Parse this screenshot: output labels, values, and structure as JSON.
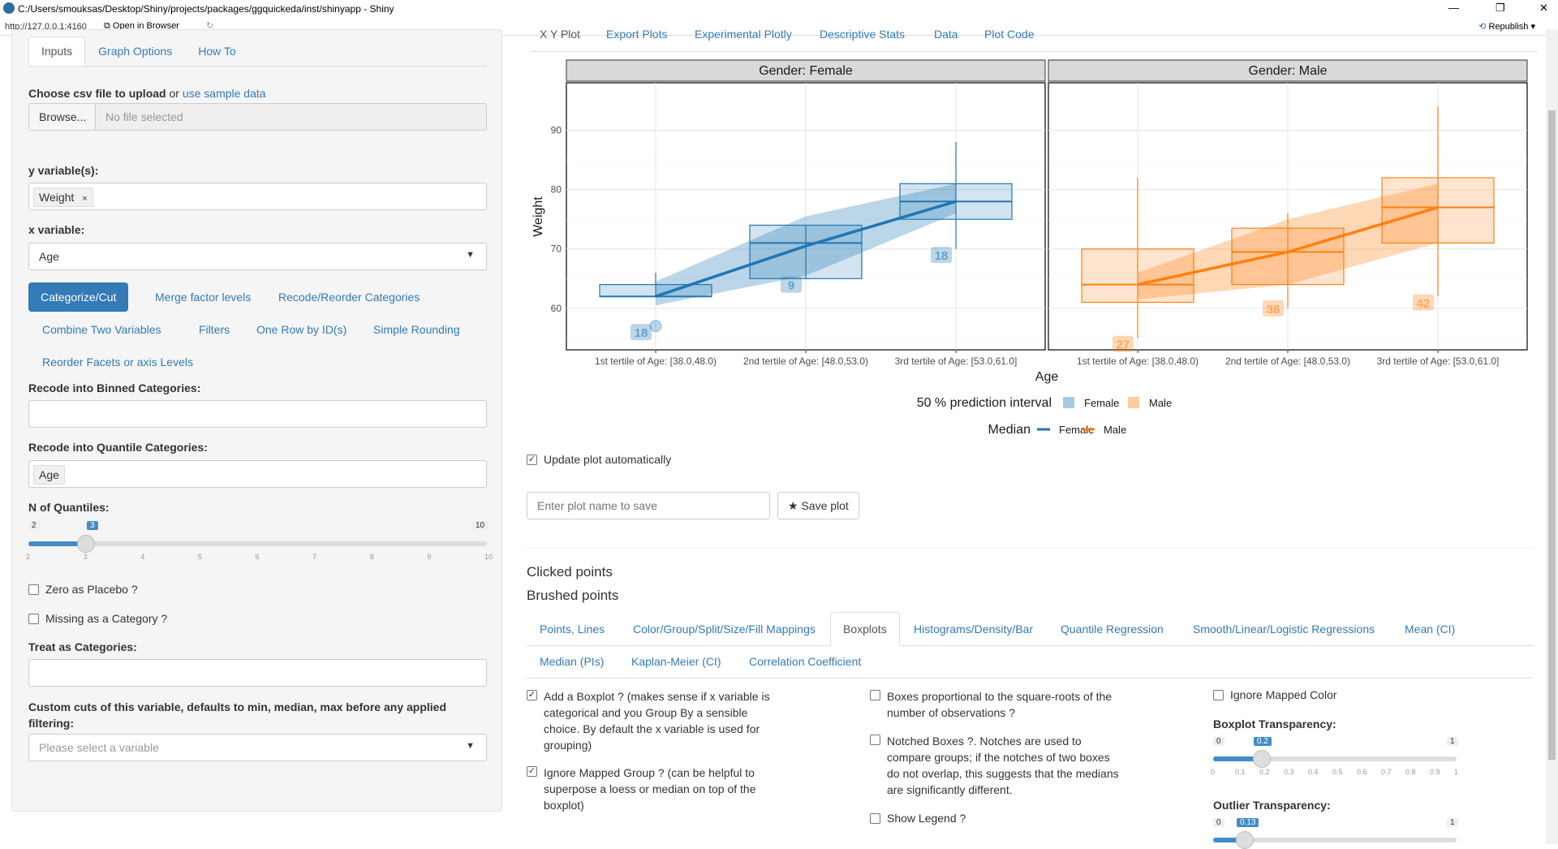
{
  "window": {
    "title": "C:/Users/smouksas/Desktop/Shiny/projects/packages/ggquickeda/inst/shinyapp - Shiny",
    "url": "http://127.0.0.1:4160",
    "open_in_browser": "Open in Browser",
    "republish": "Republish"
  },
  "sidebar": {
    "tabs": [
      "Inputs",
      "Graph Options",
      "How To"
    ],
    "upload_label": "Choose csv file to upload",
    "upload_or": "or",
    "upload_link": "use sample data",
    "browse": "Browse...",
    "no_file": "No file selected",
    "y_label": "y variable(s):",
    "y_tag": "Weight",
    "x_label": "x variable:",
    "x_value": "Age",
    "pills": [
      "Categorize/Cut",
      "Merge factor levels",
      "Recode/Reorder Categories",
      "Combine Two Variables",
      "Filters",
      "One Row by ID(s)",
      "Simple Rounding",
      "Reorder Facets or axis Levels"
    ],
    "binned_label": "Recode into Binned Categories:",
    "quantile_label": "Recode into Quantile Categories:",
    "quantile_value": "Age",
    "nq_label": "N of Quantiles:",
    "nq_min": "2",
    "nq_max": "10",
    "nq_value": "3",
    "nq_fraction": 0.125,
    "nq_ticks": [
      "2",
      "3",
      "4",
      "5",
      "6",
      "7",
      "8",
      "9",
      "10"
    ],
    "zero_placebo": "Zero as Placebo ?",
    "missing_cat": "Missing as a Category ?",
    "treat_label": "Treat as Categories:",
    "custom_cuts_label": "Custom cuts of this variable, defaults to min, median, max before any applied filtering:",
    "custom_cuts_placeholder": "Please select a variable"
  },
  "main": {
    "tabs": [
      "X Y Plot",
      "Export Plots",
      "Experimental Plotly",
      "Descriptive Stats",
      "Data",
      "Plot Code"
    ],
    "update_auto": "Update plot automatically",
    "plot_name_placeholder": "Enter plot name to save",
    "save_plot": "Save plot",
    "clicked": "Clicked points",
    "brushed": "Brushed points",
    "subtabs_row1": [
      "Points, Lines",
      "Color/Group/Split/Size/Fill Mappings",
      "Boxplots",
      "Histograms/Density/Bar",
      "Quantile Regression",
      "Smooth/Linear/Logistic Regressions",
      "Mean (CI)"
    ],
    "subtabs_row2": [
      "Median (PIs)",
      "Kaplan-Meier (CI)",
      "Correlation Coefficient"
    ],
    "box_opts": {
      "add_boxplot": "Add a Boxplot ? (makes sense if x variable is categorical and you Group By a sensible choice. By default the x variable is used for grouping)",
      "ignore_group": "Ignore Mapped Group ? (can be helpful to superpose a loess or median on top of the boxplot)",
      "prop_boxes": "Boxes proportional to the square-roots of the number of observations ?",
      "notched": "Notched Boxes ?. Notches are used to compare groups; if the notches of two boxes do not overlap, this suggests that the medians are significantly different.",
      "show_legend": "Show Legend ?",
      "ignore_color": "Ignore Mapped Color",
      "bp_transp_label": "Boxplot Transparency:",
      "bp_min": "0",
      "bp_max": "1",
      "bp_value": "0.2",
      "bp_fraction": 0.2,
      "bp_ticks": [
        "0",
        "0.1",
        "0.2",
        "0.3",
        "0.4",
        "0.5",
        "0.6",
        "0.7",
        "0.8",
        "0.9",
        "1"
      ],
      "out_transp_label": "Outlier Transparency:",
      "out_min": "0",
      "out_max": "1",
      "out_value": "0.13",
      "out_fraction": 0.13
    }
  },
  "chart_data": {
    "type": "box",
    "facets": [
      "Gender: Female",
      "Gender: Male"
    ],
    "categories": [
      "1st tertile of Age: [38.0,48.0)",
      "2nd tertile of Age: [48.0,53.0)",
      "3rd tertile of Age: [53.0,61.0]"
    ],
    "xlabel": "Age",
    "ylabel": "Weight",
    "ylim": [
      53,
      98
    ],
    "yticks": [
      60,
      70,
      80,
      90
    ],
    "series": [
      {
        "name": "Female",
        "color": "#1f77b4",
        "boxes": [
          {
            "low": 62,
            "q1": 62,
            "median": 62,
            "q3": 64,
            "high": 66,
            "n": "18",
            "n_y": 56
          },
          {
            "low": 65,
            "q1": 65,
            "median": 71,
            "q3": 74,
            "high": 74,
            "n": "9",
            "n_y": 64
          },
          {
            "low": 70,
            "q1": 75,
            "median": 78,
            "q3": 81,
            "high": 88,
            "n": "18",
            "n_y": 69
          }
        ],
        "outliers": [
          {
            "x": 0,
            "y": 57
          }
        ],
        "pi": [
          [
            60.5,
            64.5
          ],
          [
            65.5,
            75.5
          ],
          [
            76,
            81
          ]
        ],
        "median_line": [
          62,
          70.5,
          78
        ]
      },
      {
        "name": "Male",
        "color": "#ff7f0e",
        "boxes": [
          {
            "low": 55,
            "q1": 61,
            "median": 64,
            "q3": 70,
            "high": 82,
            "n": "27",
            "n_y": 54
          },
          {
            "low": 60,
            "q1": 64,
            "median": 69.5,
            "q3": 73.5,
            "high": 76,
            "n": "36",
            "n_y": 60
          },
          {
            "low": 62,
            "q1": 71,
            "median": 77,
            "q3": 82,
            "high": 94,
            "n": "42",
            "n_y": 61
          }
        ],
        "outliers": [],
        "pi": [
          [
            61.5,
            66
          ],
          [
            64,
            75
          ],
          [
            71,
            81
          ]
        ],
        "median_line": [
          64,
          69.5,
          77
        ]
      }
    ],
    "legend": {
      "pi_title": "50 % prediction interval",
      "median_title": "Median",
      "entries": [
        "Female",
        "Male"
      ]
    }
  }
}
